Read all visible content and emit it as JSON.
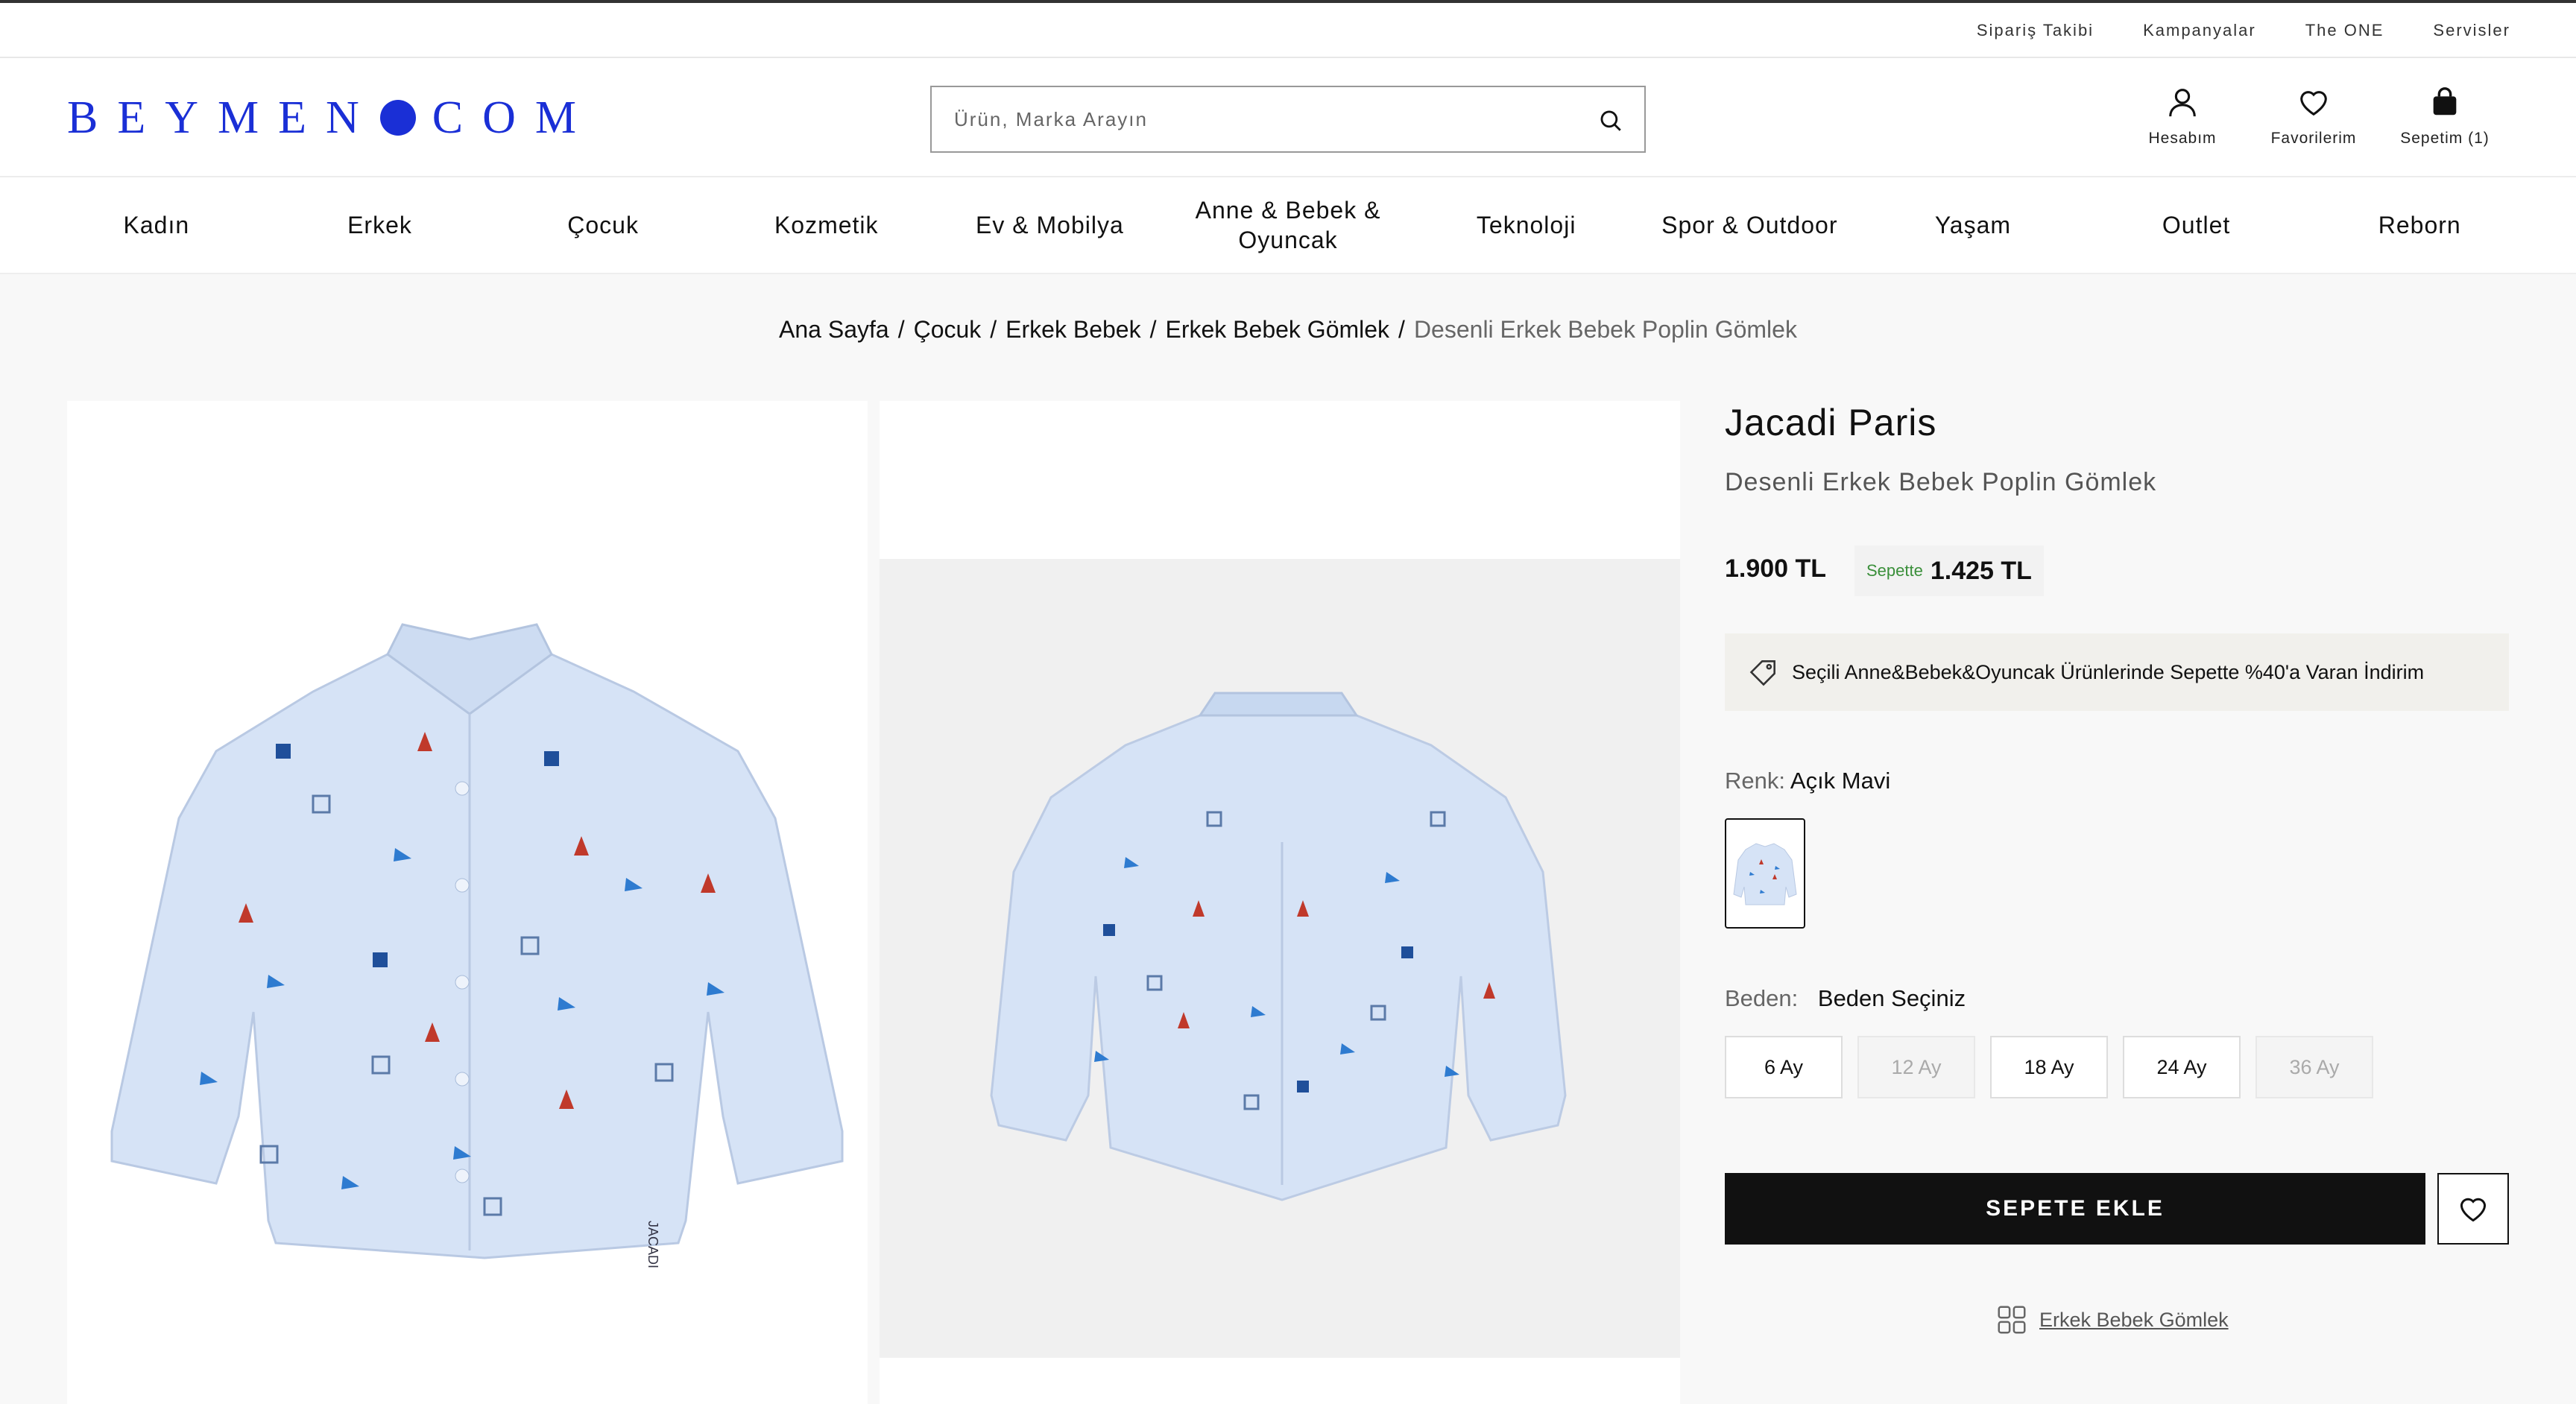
{
  "topbar": {
    "links": [
      "Sipariş Takibi",
      "Kampanyalar",
      "The ONE",
      "Servisler"
    ]
  },
  "header": {
    "logo_left": "BEYMEN",
    "logo_right": "COM",
    "search_placeholder": "Ürün, Marka Arayın",
    "account_label": "Hesabım",
    "favorites_label": "Favorilerim",
    "cart_label": "Sepetim (1)"
  },
  "nav": {
    "items": [
      "Kadın",
      "Erkek",
      "Çocuk",
      "Kozmetik",
      "Ev & Mobilya",
      "Anne & Bebek & Oyuncak",
      "Teknoloji",
      "Spor & Outdoor",
      "Yaşam",
      "Outlet",
      "Reborn"
    ]
  },
  "breadcrumb": {
    "items": [
      "Ana Sayfa",
      "Çocuk",
      "Erkek Bebek",
      "Erkek Bebek Gömlek"
    ],
    "current": "Desenli Erkek Bebek Poplin Gömlek"
  },
  "product": {
    "brand": "Jacadi Paris",
    "name": "Desenli Erkek Bebek Poplin Gömlek",
    "price": "1.900 TL",
    "basket_label": "Sepette",
    "basket_price": "1.425 TL",
    "promo": "Seçili Anne&Bebek&Oyuncak Ürünlerinde Sepette %40'a Varan İndirim",
    "color_label": "Renk:",
    "color_value": "Açık Mavi",
    "size_label": "Beden:",
    "size_value": "Beden Seçiniz",
    "sizes": [
      {
        "label": "6 Ay",
        "available": true
      },
      {
        "label": "12 Ay",
        "available": false
      },
      {
        "label": "18 Ay",
        "available": true
      },
      {
        "label": "24 Ay",
        "available": true
      },
      {
        "label": "36 Ay",
        "available": false
      }
    ],
    "add_to_cart": "SEPETE EKLE",
    "category_link": "Erkek Bebek Gömlek"
  },
  "colors": {
    "brand_blue": "#1a2fd6",
    "shirt_blue": "#d6e3f6",
    "button_black": "#111111",
    "basket_green": "#3a8f3a"
  }
}
